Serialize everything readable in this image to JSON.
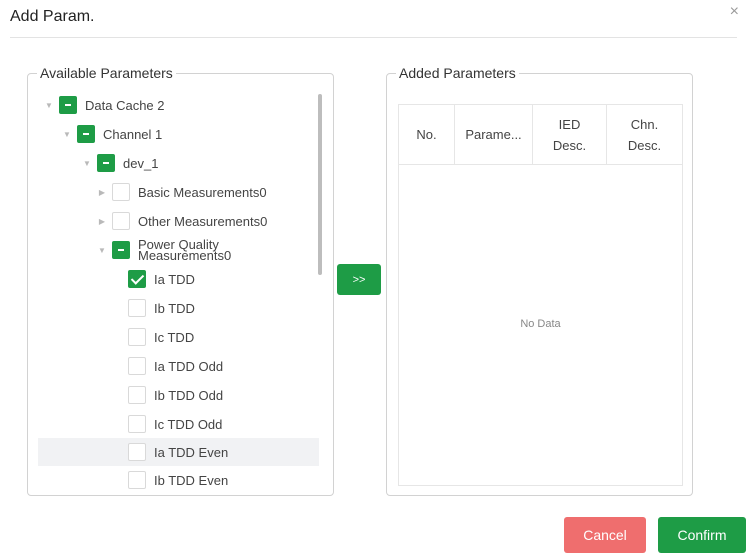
{
  "dialog": {
    "title": "Add Param.",
    "close_glyph": "×"
  },
  "available": {
    "legend": "Available Parameters",
    "tree": [
      {
        "label": "Data Cache 2",
        "arrow": "▼",
        "check": "partial"
      },
      {
        "label": "Channel 1",
        "arrow": "▼",
        "check": "partial"
      },
      {
        "label": "dev_1",
        "arrow": "▼",
        "check": "partial"
      },
      {
        "label": "Basic Measurements0",
        "arrow": "▶",
        "check": "unchecked"
      },
      {
        "label": "Other Measurements0",
        "arrow": "▶",
        "check": "unchecked"
      },
      {
        "label_line1": "Power Quality",
        "label_line2": "Measurements0",
        "arrow": "▼",
        "check": "partial"
      },
      {
        "label": "Ia TDD",
        "check": "checked"
      },
      {
        "label": "Ib TDD",
        "check": "unchecked"
      },
      {
        "label": "Ic TDD",
        "check": "unchecked"
      },
      {
        "label": "Ia TDD Odd",
        "check": "unchecked"
      },
      {
        "label": "Ib TDD Odd",
        "check": "unchecked"
      },
      {
        "label": "Ic TDD Odd",
        "check": "unchecked"
      },
      {
        "label": "Ia TDD Even",
        "check": "unchecked",
        "highlighted": true
      },
      {
        "label": "Ib TDD Even",
        "check": "unchecked"
      }
    ]
  },
  "transfer_button": {
    "label": ">>"
  },
  "added": {
    "legend": "Added Parameters",
    "columns": [
      {
        "line1": "No."
      },
      {
        "line1": "Parame..."
      },
      {
        "line1": "IED",
        "line2": "Desc."
      },
      {
        "line1": "Chn.",
        "line2": "Desc."
      }
    ],
    "empty_text": "No Data"
  },
  "footer": {
    "cancel_label": "Cancel",
    "confirm_label": "Confirm"
  },
  "colors": {
    "accent": "#1e9c46",
    "cancel": "#ef6e6e"
  }
}
